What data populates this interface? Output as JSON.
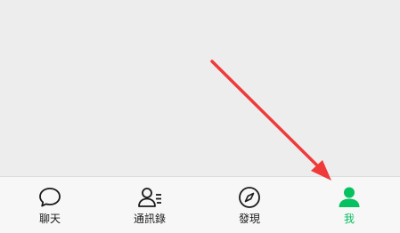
{
  "tabbar": {
    "tabs": [
      {
        "label": "聊天",
        "icon": "chat-bubble-icon",
        "active": false
      },
      {
        "label": "通訊錄",
        "icon": "contacts-icon",
        "active": false
      },
      {
        "label": "發現",
        "icon": "compass-icon",
        "active": false
      },
      {
        "label": "我",
        "icon": "person-icon",
        "active": true
      }
    ]
  },
  "colors": {
    "background": "#ededed",
    "tabbar_background": "#f7f7f7",
    "active": "#07c160",
    "inactive": "#1a1a1a",
    "annotation_arrow": "#f03a3a"
  }
}
